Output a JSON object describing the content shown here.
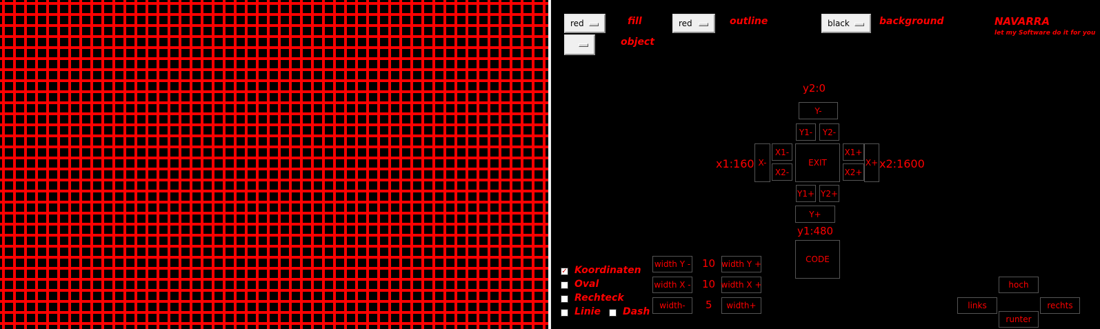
{
  "colors": {
    "accent": "#ff0000",
    "panel_bg": "#000000",
    "grid_line": "#ff0000"
  },
  "top": {
    "fill_value": "red",
    "fill_label": "fill",
    "outline_value": "red",
    "outline_label": "outline",
    "background_value": "black",
    "background_label": "background",
    "object_value": "",
    "object_label": "object"
  },
  "brand": {
    "name": "NAVARRA",
    "tagline": "let my Software do it for you"
  },
  "coords": {
    "y2": "y2:0",
    "y1": "y1:480",
    "x1": "x1:1600",
    "x2": "x2:1600"
  },
  "nav": {
    "y_minus": "Y-",
    "y1_minus": "Y1-",
    "y2_minus": "Y2-",
    "x_minus": "X-",
    "x1_minus": "X1-",
    "x2_minus": "X2-",
    "exit": "EXIT",
    "x1_plus": "X1+",
    "x2_plus": "X2+",
    "x_plus": "X+",
    "y1_plus": "Y1+",
    "y2_plus": "Y2+",
    "y_plus": "Y+",
    "code": "CODE"
  },
  "options": {
    "koordinaten": {
      "label": "Koordinaten",
      "checked": true
    },
    "oval": {
      "label": "Oval",
      "checked": false
    },
    "rechteck": {
      "label": "Rechteck",
      "checked": false
    },
    "linie": {
      "label": "Linie",
      "checked": false
    },
    "dash": {
      "label": "Dash",
      "checked": false
    }
  },
  "widths": {
    "width_y_minus": "width Y -",
    "width_y_value": "10",
    "width_y_plus": "width Y +",
    "width_x_minus": "width X -",
    "width_x_value": "10",
    "width_x_plus": "width X +",
    "width_minus": "width-",
    "width_value": "5",
    "width_plus": "width+"
  },
  "move": {
    "hoch": "hoch",
    "links": "links",
    "rechts": "rechts",
    "runter": "runter"
  }
}
